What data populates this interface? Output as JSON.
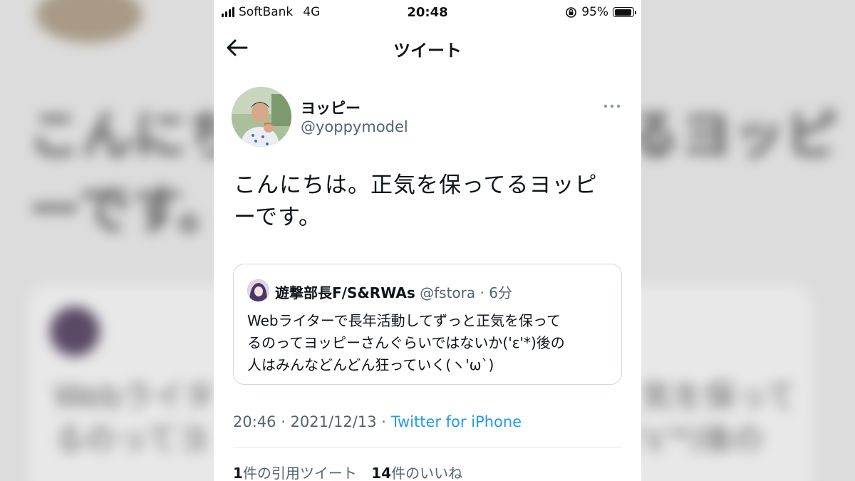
{
  "status_bar": {
    "carrier": "SoftBank",
    "network": "4G",
    "time": "20:48",
    "battery_percent": "95%",
    "battery_level": 0.95,
    "icons": [
      "signal-icon",
      "orientation-lock-icon",
      "battery-icon"
    ]
  },
  "nav": {
    "title": "ツイート",
    "back_icon": "back-arrow-icon"
  },
  "tweet": {
    "display_name": "ヨッピー",
    "handle": "@yoppymodel",
    "more_icon": "more-dots-icon",
    "text_line1": "こんにちは。正気を保ってるヨッピ",
    "text_line2": "ーです。",
    "timestamp": "20:46 · 2021/12/13 · ",
    "client": "Twitter for iPhone"
  },
  "quoted_tweet": {
    "display_name": "遊撃部長F/S&RWAs",
    "handle_time": " @fstora · 6分",
    "text_line1": "Webライターで長年活動してずっと正気を保って",
    "text_line2": "るのってヨッピーさんぐらいではないか('ε'*)後の",
    "text_line3": "人はみんなどんどん狂っていく(ヽ'ω`)"
  },
  "stats": {
    "quote_count": "1",
    "quote_label": "件の引用ツイート",
    "like_count": "14",
    "like_label": "件のいいね"
  },
  "background_blur_text": {
    "line1": "こんにちは",
    "line1_right": "るヨッピ",
    "line2": "ーです。",
    "card_line1": "Webライタ",
    "card_line1_right": "気を保って",
    "card_line2": "るのってヨ",
    "card_line2_right": "('ε'*)後の"
  },
  "colors": {
    "link_blue": "#1d9bf0",
    "secondary_text": "#536471",
    "primary_text": "#0f1419",
    "border": "#cfd9de"
  }
}
